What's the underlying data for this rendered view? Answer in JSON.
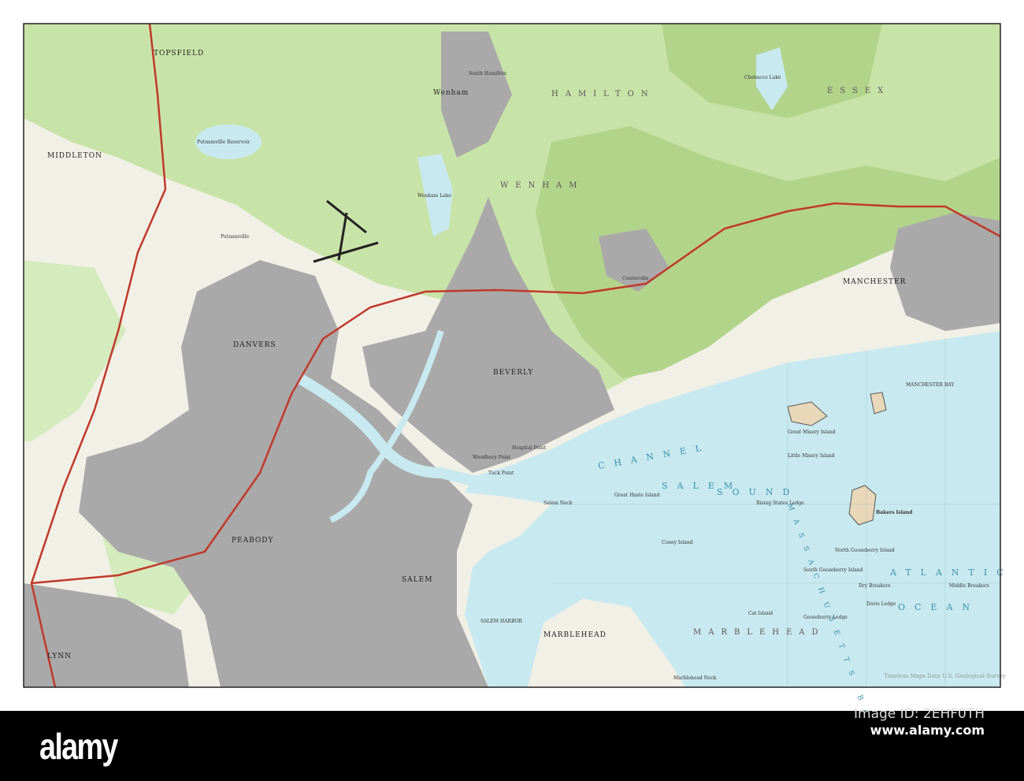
{
  "map": {
    "colors": {
      "land": "#f1f0e6",
      "forest": "#c8e3a8",
      "forest_dark": "#b2d48a",
      "urban": "#a9a9a9",
      "water": "#c8e9ef",
      "highway": "#c0392b",
      "border": "#222222"
    },
    "towns": [
      "TOPSFIELD",
      "MIDDLETON",
      "DANVERS",
      "PEABODY",
      "SALEM",
      "BEVERLY",
      "MARBLEHEAD",
      "MANCHESTER",
      "Wenham",
      "LYNN",
      "South Hamilton",
      "Centerville",
      "Salem Neck",
      "Marblehead Neck",
      "Putnamville"
    ],
    "regions": [
      "HAMILTON",
      "ESSEX",
      "WENHAM",
      "MARBLEHEAD"
    ],
    "water_labels": [
      "ATLANTIC",
      "OCEAN",
      "SALEM",
      "SOUND",
      "MANCHESTER BAY",
      "CHANNEL",
      "SALEM HARBOR",
      "MASSACHUSETTS BAY"
    ],
    "features": [
      "Putnamville Reservoir",
      "Wenham Lake",
      "Chebacco Lake",
      "Bakers Island",
      "Great Misery Island",
      "Little Misery Island",
      "North Gooseberry Island",
      "South Gooseberry Island",
      "Cat Island",
      "Coney Island",
      "Davis Ledge",
      "Dry Breakers",
      "Middle Breakers",
      "Gooseberry Ledge",
      "Rising States Ledge",
      "Great Haste Island",
      "Hospital Point",
      "Tuck Point",
      "Woodbury Point"
    ],
    "credit": "Timeless Maps Data U.S. Geological Survey"
  },
  "watermark": {
    "logo": "alamy",
    "image_id": "Image ID: 2EHF0TH",
    "site": "www.alamy.com"
  }
}
